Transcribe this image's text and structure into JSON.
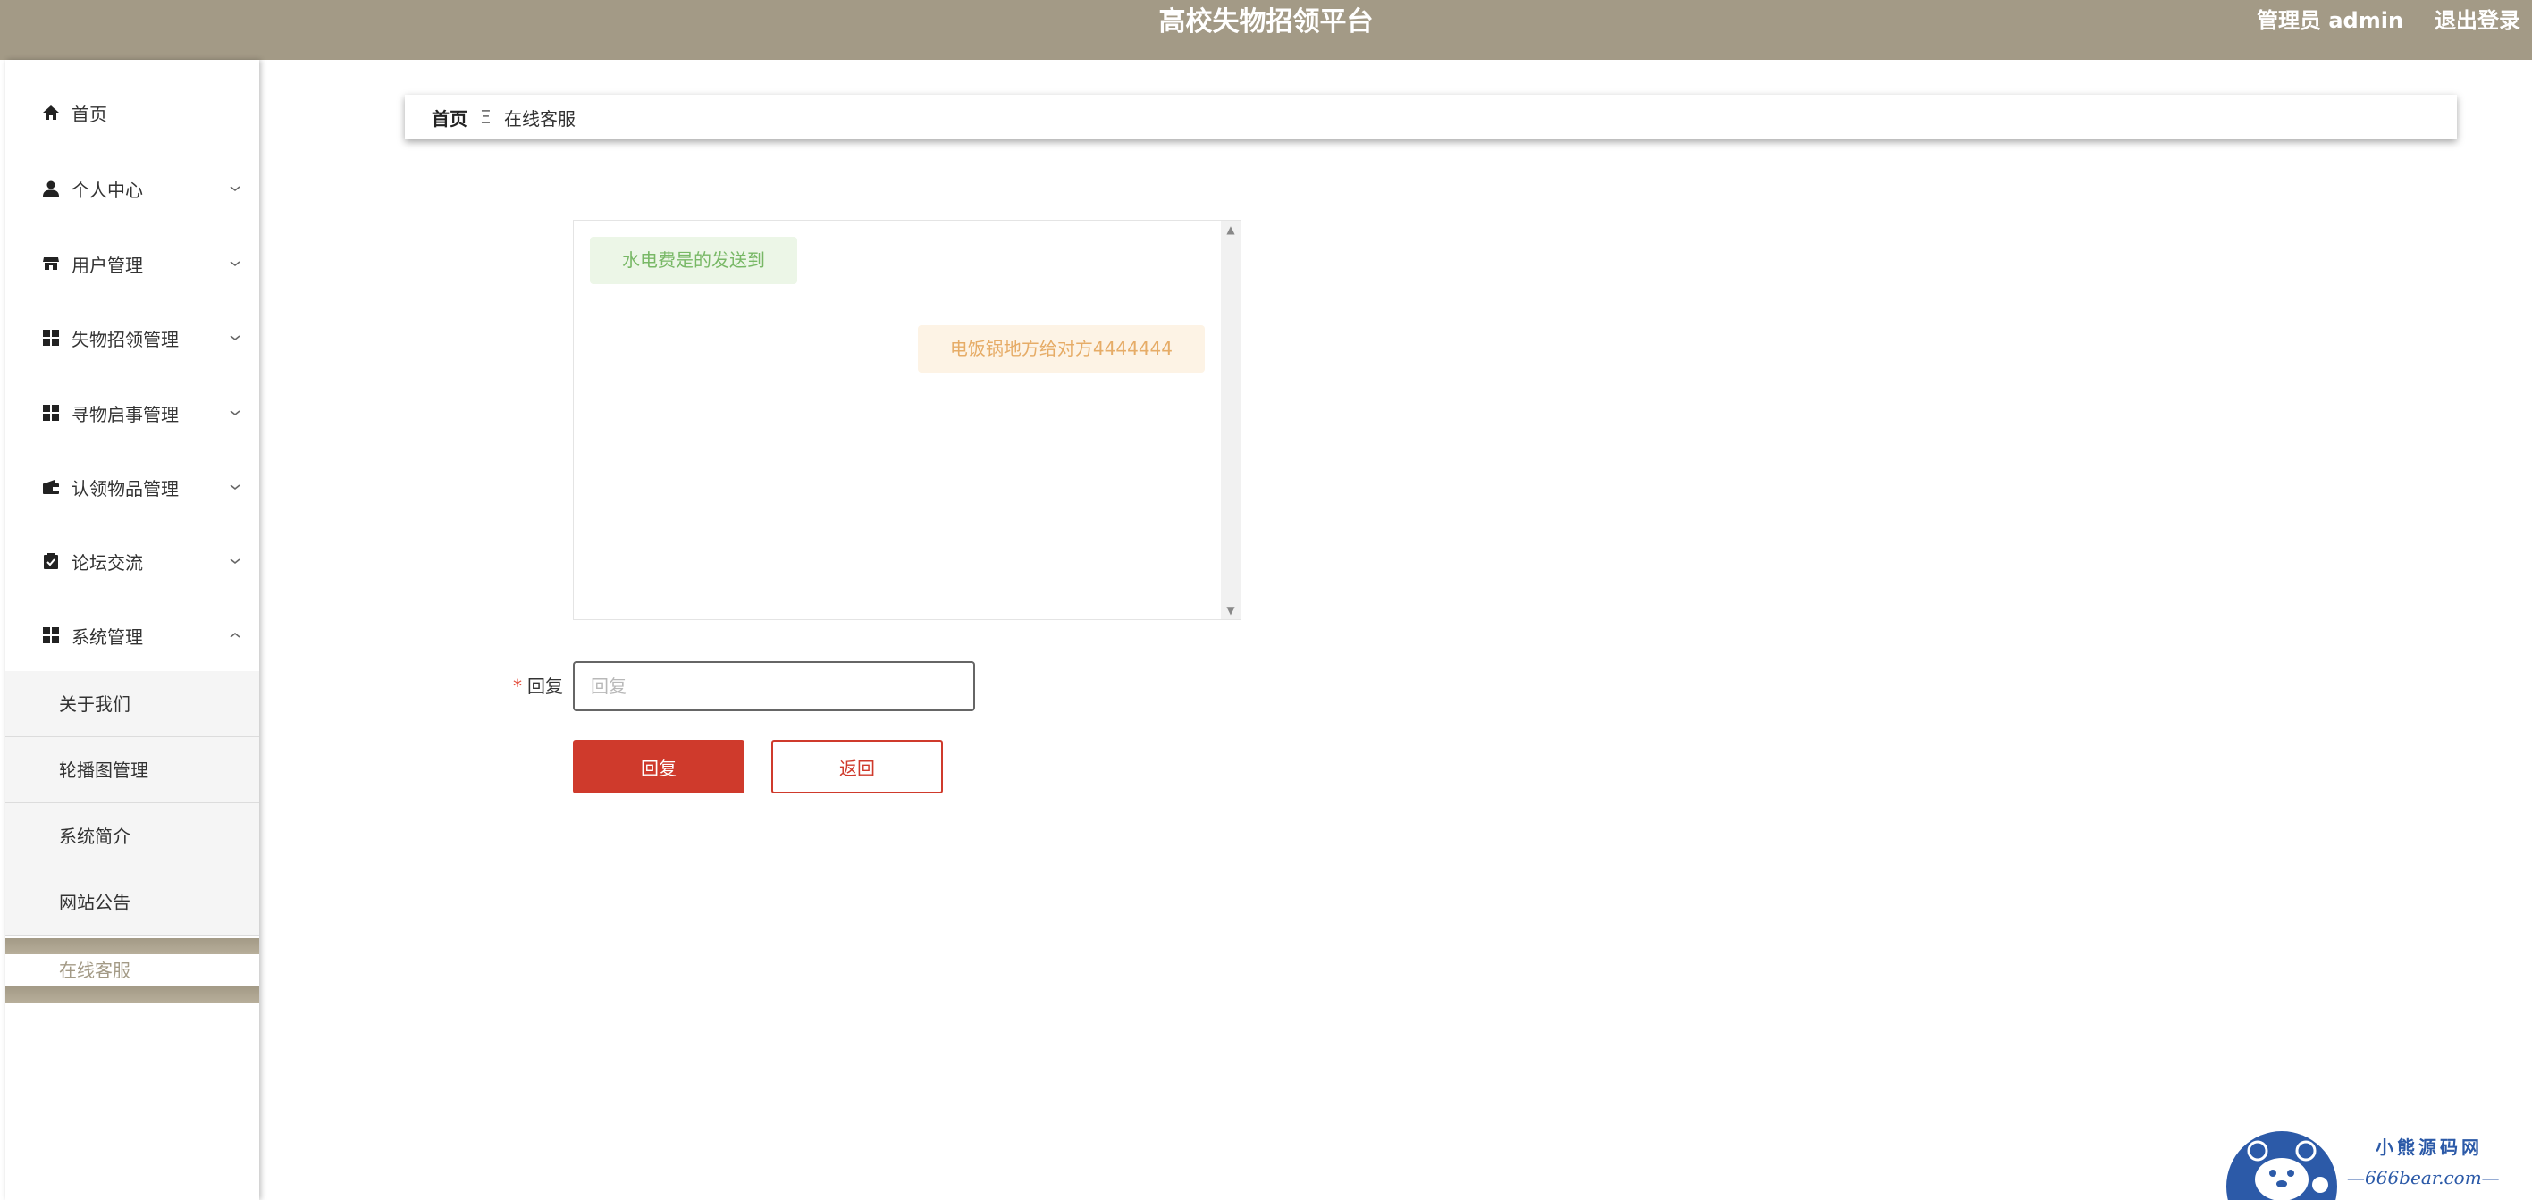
{
  "header": {
    "title": "高校失物招领平台",
    "admin_label": "管理员 admin",
    "logout_label": "退出登录"
  },
  "sidebar": {
    "items": [
      {
        "label": "首页",
        "icon": "home-icon"
      },
      {
        "label": "个人中心",
        "icon": "user-icon"
      },
      {
        "label": "用户管理",
        "icon": "store-icon"
      },
      {
        "label": "失物招领管理",
        "icon": "grid-icon"
      },
      {
        "label": "寻物启事管理",
        "icon": "grid-icon"
      },
      {
        "label": "认领物品管理",
        "icon": "wallet-icon"
      },
      {
        "label": "论坛交流",
        "icon": "clipboard-check-icon"
      },
      {
        "label": "系统管理",
        "icon": "grid-icon"
      }
    ],
    "sub_items": [
      "关于我们",
      "轮播图管理",
      "系统简介",
      "网站公告"
    ],
    "active_sub_item": "在线客服"
  },
  "breadcrumb": {
    "home": "首页",
    "separator": "Ξ",
    "current": "在线客服"
  },
  "chat": {
    "messages": [
      {
        "side": "left",
        "text": "水电费是的发送到"
      },
      {
        "side": "right",
        "text": "电饭锅地方给对方4444444"
      }
    ]
  },
  "form": {
    "reply_label": "回复",
    "reply_placeholder": "回复",
    "reply_value": "",
    "submit_label": "回复",
    "back_label": "返回"
  },
  "watermark": {
    "title": "小熊源码网",
    "subtitle": "—666bear.com—"
  },
  "colors": {
    "header_bg": "#a39a86",
    "primary_red": "#cf3a2c",
    "left_msg_bg": "#ecf6e7",
    "left_msg_text": "#78b866",
    "right_msg_bg": "#fdf3e5",
    "right_msg_text": "#e6ac67"
  }
}
